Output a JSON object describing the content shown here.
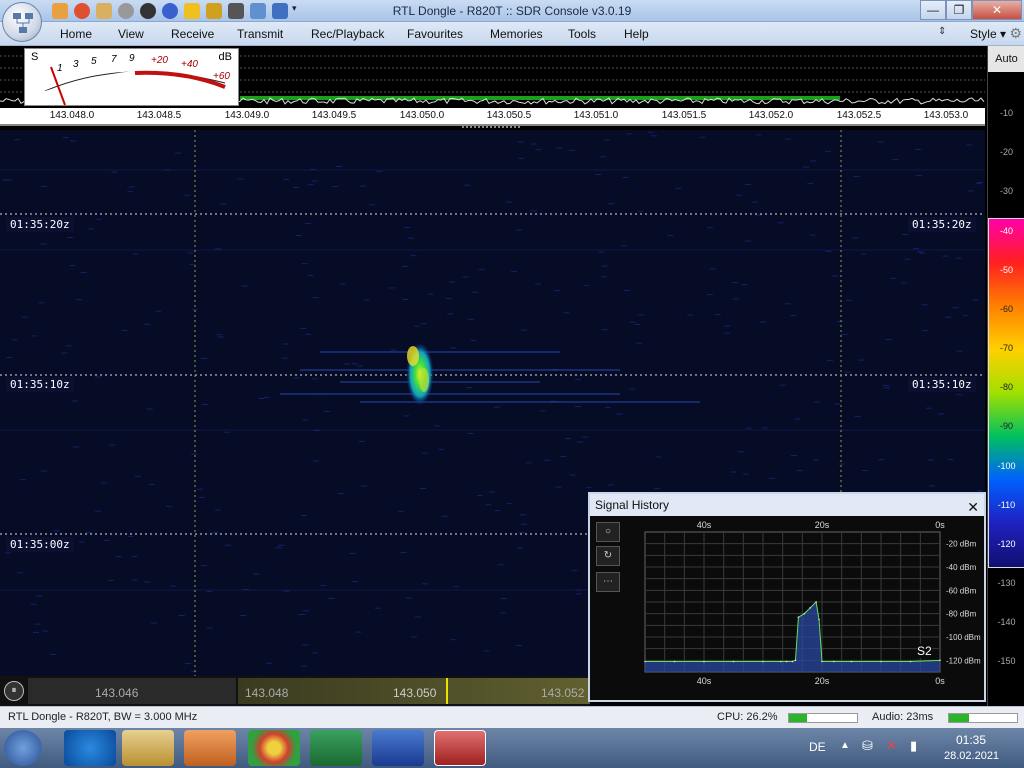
{
  "window": {
    "title": "RTL Dongle - R820T :: SDR Console v3.0.19",
    "buttons": {
      "minimize": "—",
      "restore": "❐",
      "close": "✕"
    }
  },
  "menu": {
    "items": [
      "Home",
      "View",
      "Receive",
      "Transmit",
      "Rec/Playback",
      "Favourites",
      "Memories",
      "Tools",
      "Help"
    ],
    "style": "Style"
  },
  "smeter": {
    "s_label": "S",
    "db_label": "dB",
    "s_scale": [
      "1",
      "3",
      "5",
      "7",
      "9"
    ],
    "db_scale": [
      "+20",
      "+40",
      "+60"
    ]
  },
  "freq_axis": {
    "labels": [
      "143.048.0",
      "143.048.5",
      "143.049.0",
      "143.049.5",
      "143.050.0",
      "143.050.5",
      "143.051.0",
      "143.051.5",
      "143.052.0",
      "143.052.5",
      "143.053.0"
    ]
  },
  "waterfall": {
    "time_labels": [
      "01:35:20z",
      "01:35:10z",
      "01:35:00z"
    ]
  },
  "right_scale": {
    "auto": "Auto",
    "ticks": [
      "-10",
      "-20",
      "-30",
      "-40",
      "-50",
      "-60",
      "-70",
      "-80",
      "-90",
      "-100",
      "-110",
      "-120",
      "-130",
      "-140",
      "-150"
    ],
    "colors": [
      "#ff00aa",
      "#ff2020",
      "#ff8000",
      "#ffd000",
      "#a0e000",
      "#00c060",
      "#0060ff",
      "#2020c0",
      "#101070"
    ]
  },
  "tuning_strip": {
    "labels": [
      "143.046",
      "143.048",
      "143.050",
      "143.052"
    ]
  },
  "signal_history": {
    "title": "Signal History",
    "close": "✕",
    "buttons": [
      "○",
      "↻",
      "⋯"
    ],
    "smeter_label": "S2"
  },
  "chart_data": {
    "type": "area",
    "title": "Signal History",
    "x_ticks_top": [
      "40s",
      "20s",
      "0s"
    ],
    "x_ticks_bottom": [
      "40s",
      "20s",
      "0s"
    ],
    "y_ticks": [
      "-20 dBm",
      "-40 dBm",
      "-60 dBm",
      "-80 dBm",
      "-100 dBm",
      "-120 dBm"
    ],
    "xlim": [
      50,
      0
    ],
    "ylim": [
      -130,
      -10
    ],
    "x": [
      50,
      45,
      40,
      35,
      30,
      27,
      26,
      25,
      24.5,
      24,
      23,
      22,
      21,
      20.5,
      20,
      18,
      15,
      10,
      5,
      0
    ],
    "values": [
      -121,
      -121,
      -121,
      -121,
      -121,
      -121,
      -121,
      -121,
      -120,
      -83,
      -80,
      -75,
      -70,
      -85,
      -121,
      -121,
      -121,
      -121,
      -121,
      -120
    ]
  },
  "status": {
    "left": "RTL Dongle - R820T, BW = 3.000 MHz",
    "cpu": "CPU: 26.2%",
    "audio": "Audio: 23ms",
    "cpu_level": 0.262,
    "audio_level": 0.3
  },
  "taskbar": {
    "lang": "DE",
    "time": "01:35",
    "date": "28.02.2021"
  }
}
